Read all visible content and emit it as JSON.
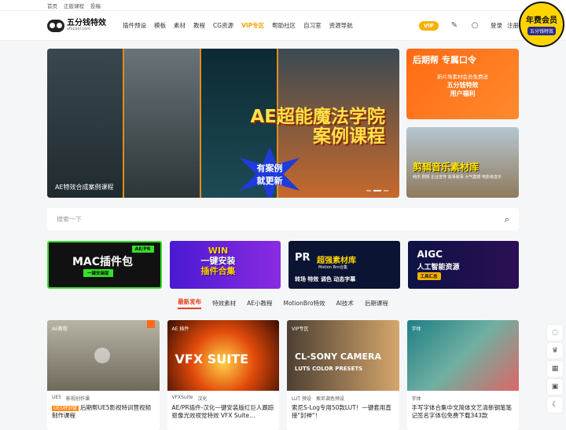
{
  "topbar": {
    "links": [
      "首页",
      "正版课程",
      "投稿"
    ]
  },
  "header": {
    "logo_title": "五分钱特效",
    "logo_domain": "vfxcool.com",
    "menu": [
      "插件预设",
      "模板",
      "素材",
      "教程",
      "CG资源",
      "VIP专区",
      "帮助社区",
      "自习室",
      "资源导航"
    ],
    "vip_label": "VIP",
    "login": "登录",
    "register": "注册"
  },
  "badge": {
    "main": "年费会员",
    "sub": "五分钱特效"
  },
  "hero": {
    "title_line1": "AE超能魔法学院",
    "title_line2": "案例课程",
    "star_line1": "有案例",
    "star_line2": "就更新",
    "caption": "AE特效合成案例课程"
  },
  "side1": {
    "title": "后期帮 专属口令",
    "line1": "新片场素材会员免费送",
    "line2": "五分钱特效",
    "line3": "用户福利"
  },
  "side2": {
    "title": "剪辑音乐素材库",
    "tags": "纯乐 剧情 企业宣传 故事叙事 大气震撼 电影级音乐"
  },
  "search": {
    "placeholder": "搜索一下"
  },
  "banners": [
    {
      "title": "MAC插件包",
      "tag": "AE/PR",
      "sub": "一键安装版"
    },
    {
      "title1": "WIN",
      "title2": "一键安装",
      "title3": "插件合集"
    },
    {
      "title": "PR",
      "title2": "超强素材库",
      "sub": "Motion Bro合集",
      "foot": "转场 特效 调色 动态字幕"
    },
    {
      "title": "AIGC",
      "title2": "人工智能资源",
      "sub": "工具汇总"
    }
  ],
  "tabs": [
    "最新发布",
    "特效素材",
    "AE小教程",
    "MotionBro特效",
    "AI技术",
    "后期课程"
  ],
  "cards": [
    {
      "cat": "AE教程",
      "meta1": "UE5",
      "meta2": "影视创作课",
      "badge": "UE5特训营",
      "title": "后期帮UE5影视特训营视频制作课程"
    },
    {
      "cat": "AE 插件",
      "thumb_big": "VFX SUITE",
      "meta1": "VFXSuite",
      "meta2": "汉化",
      "title": "AE/PR插件-汉化一键安装版红巨人跟踪抠像光效视觉特效 VFX Suite…"
    },
    {
      "cat": "VIP专区",
      "thumb_big": "CL-SONY CAMERA",
      "thumb_sm": "LUTS COLOR PRESETS",
      "meta1": "LUT 预设",
      "meta2": "索尼调色预设",
      "title": "索尼S-Log专用50款LUT！一键套用直接\"封神\"！"
    },
    {
      "cat": "字体",
      "meta1": "字体",
      "meta2": "",
      "title": "手写字体合集中文简体文艺清新钢笔笔记签名字体包免费下载343款"
    }
  ],
  "colors": {
    "accent": "#e8401c",
    "vip": "#f5b100",
    "orange": "#ff6a12"
  }
}
